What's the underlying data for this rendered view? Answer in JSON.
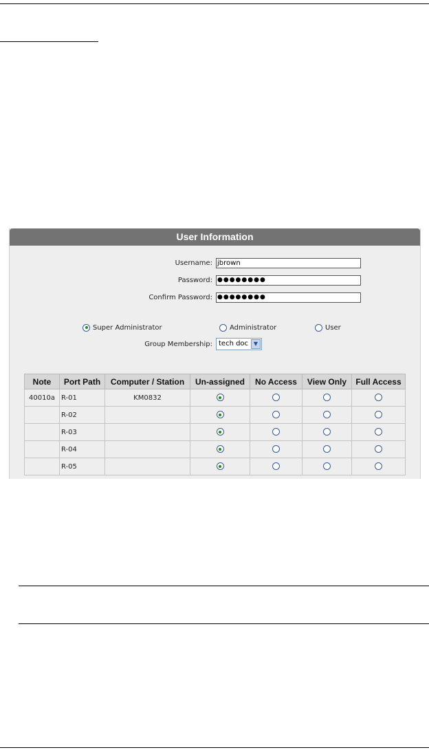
{
  "panel": {
    "title": "User Information"
  },
  "form": {
    "username_label": "Username:",
    "username_value": "jbrown",
    "password_label": "Password:",
    "password_value": "●●●●●●●●",
    "confirm_label": "Confirm Password:",
    "confirm_value": "●●●●●●●●"
  },
  "roles": {
    "options": [
      "Super Administrator",
      "Administrator",
      "User"
    ],
    "selected": "Super Administrator"
  },
  "group": {
    "label": "Group Membership:",
    "selected": "tech doc"
  },
  "table": {
    "headers": [
      "Note",
      "Port Path",
      "Computer / Station",
      "Un-assigned",
      "No Access",
      "View Only",
      "Full Access"
    ],
    "rows": [
      {
        "note": "40010a",
        "port": "R-01",
        "station": "KM0832",
        "access": "Un-assigned"
      },
      {
        "note": "",
        "port": "R-02",
        "station": "",
        "access": "Un-assigned"
      },
      {
        "note": "",
        "port": "R-03",
        "station": "",
        "access": "Un-assigned"
      },
      {
        "note": "",
        "port": "R-04",
        "station": "",
        "access": "Un-assigned"
      },
      {
        "note": "",
        "port": "R-05",
        "station": "",
        "access": "Un-assigned"
      }
    ]
  },
  "colors": {
    "title_bar": "#737373",
    "panel_bg": "#eeeeee",
    "table_header_bg": "#d7d7d7",
    "radio_selected": "#1c8c1c"
  }
}
